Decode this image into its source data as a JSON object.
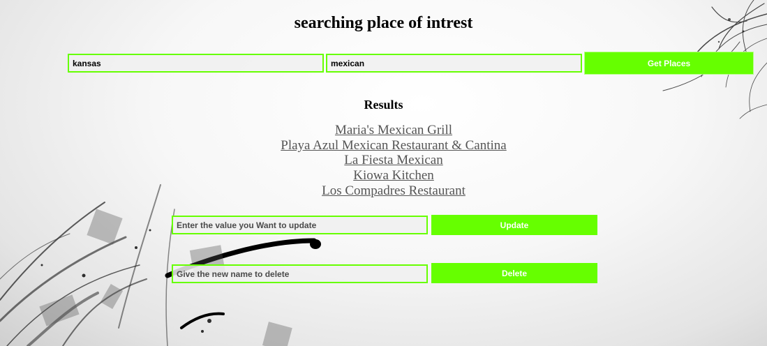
{
  "page": {
    "title": "searching place of intrest"
  },
  "search": {
    "location_value": "kansas",
    "cuisine_value": "mexican",
    "get_places_label": "Get Places"
  },
  "results": {
    "heading": "Results",
    "items": [
      "Maria's Mexican Grill",
      "Playa Azul Mexican Restaurant & Cantina",
      "La Fiesta Mexican",
      "Kiowa Kitchen",
      "Los Compadres Restaurant"
    ]
  },
  "update": {
    "placeholder": "Enter the value you Want to update",
    "button_label": "Update"
  },
  "delete": {
    "placeholder": "Give the new name to delete",
    "button_label": "Delete"
  },
  "colors": {
    "accent_green": "#66ff00",
    "link_gray": "#555555"
  }
}
